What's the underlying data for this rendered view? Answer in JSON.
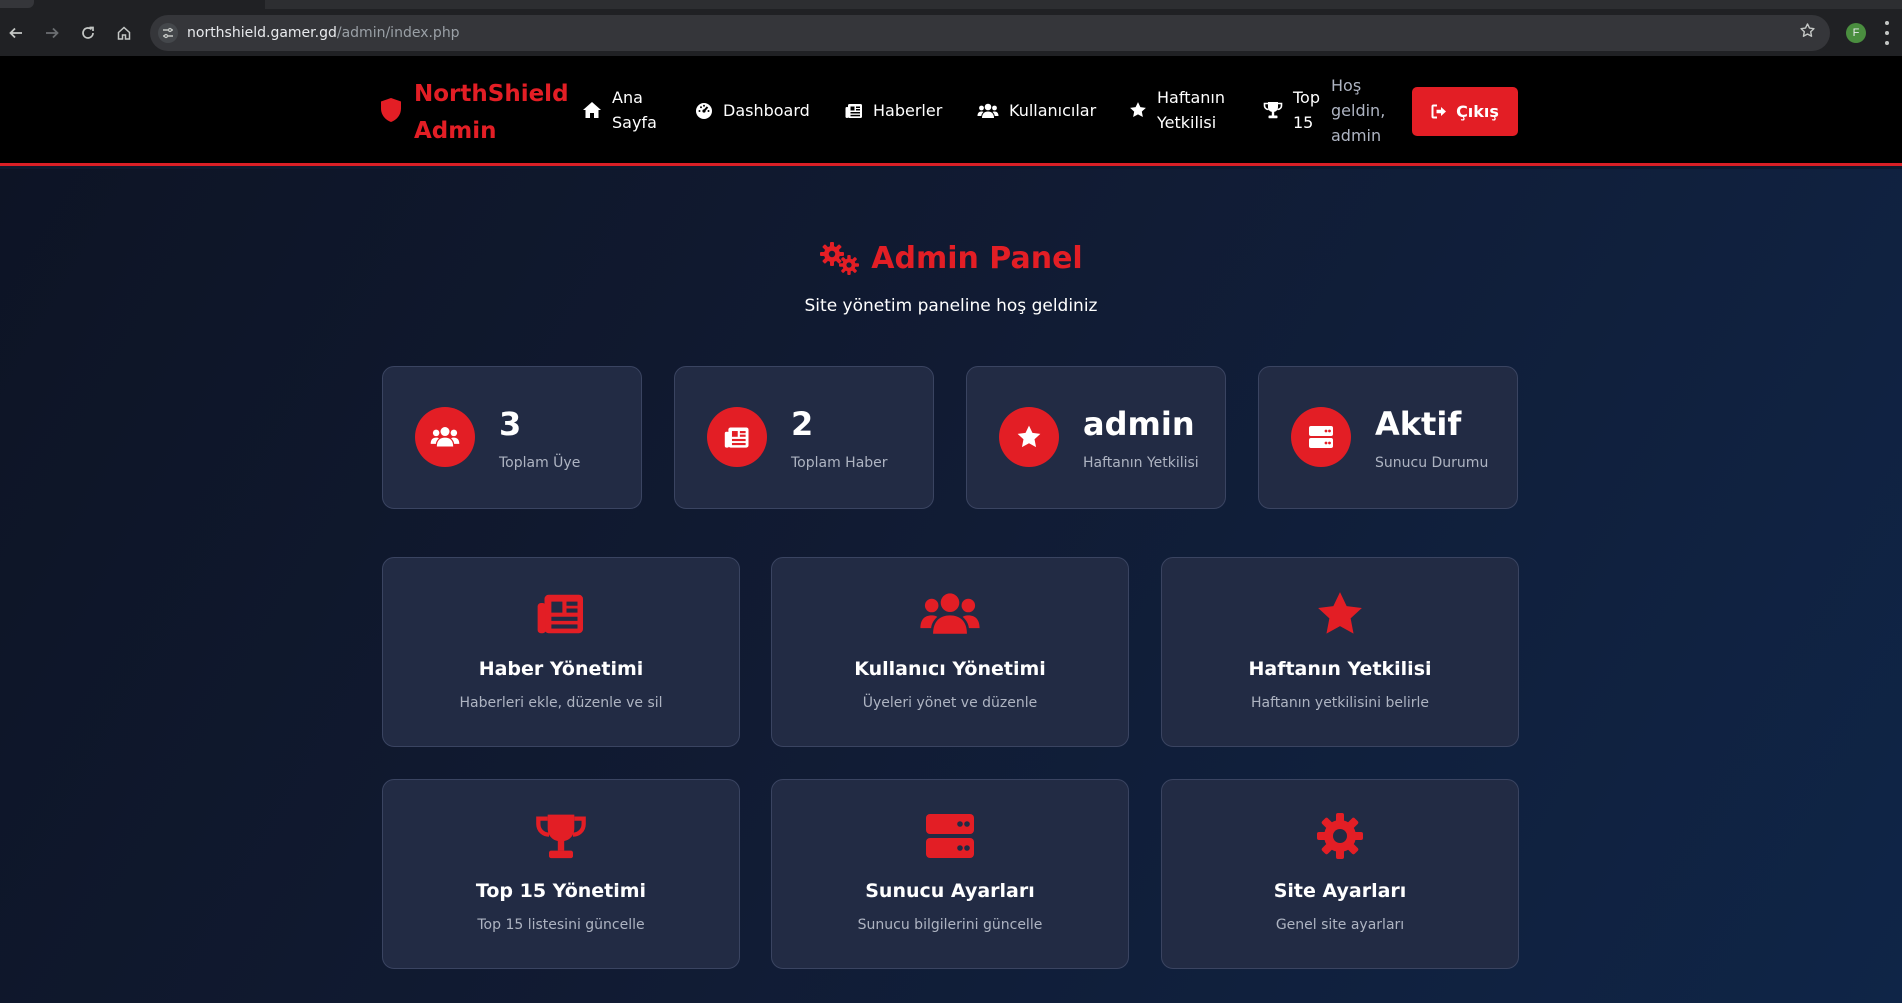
{
  "browser": {
    "url_host": "northshield.gamer.gd",
    "url_path": "/admin/index.php",
    "profile_initial": "F"
  },
  "header": {
    "brand_line1": "NorthShield",
    "brand_line2": "Admin",
    "nav": [
      {
        "line1": "Ana",
        "line2": "Sayfa",
        "icon": "home-icon"
      },
      {
        "line1": "Dashboard",
        "line2": "",
        "icon": "gauge-icon"
      },
      {
        "line1": "Haberler",
        "line2": "",
        "icon": "newspaper-icon"
      },
      {
        "line1": "Kullanıcılar",
        "line2": "",
        "icon": "users-icon"
      },
      {
        "line1": "Haftanın",
        "line2": "Yetkilisi",
        "icon": "star-icon"
      },
      {
        "line1": "Top",
        "line2": "15",
        "icon": "trophy-icon"
      }
    ],
    "welcome_line1": "Hoş",
    "welcome_line2": "geldin,",
    "welcome_line3": "admin",
    "logout_label": "Çıkış"
  },
  "panel": {
    "title": "Admin Panel",
    "subtitle": "Site yönetim paneline hoş geldiniz"
  },
  "stats": [
    {
      "value": "3",
      "label": "Toplam Üye",
      "icon": "users-icon"
    },
    {
      "value": "2",
      "label": "Toplam Haber",
      "icon": "newspaper-icon"
    },
    {
      "value": "admin",
      "label": "Haftanın Yetkilisi",
      "icon": "star-icon"
    },
    {
      "value": "Aktif",
      "label": "Sunucu Durumu",
      "icon": "server-icon"
    }
  ],
  "actions": [
    {
      "title": "Haber Yönetimi",
      "desc": "Haberleri ekle, düzenle ve sil",
      "icon": "newspaper-icon"
    },
    {
      "title": "Kullanıcı Yönetimi",
      "desc": "Üyeleri yönet ve düzenle",
      "icon": "users-icon"
    },
    {
      "title": "Haftanın Yetkilisi",
      "desc": "Haftanın yetkilisini belirle",
      "icon": "star-icon"
    },
    {
      "title": "Top 15 Yönetimi",
      "desc": "Top 15 listesini güncelle",
      "icon": "trophy-icon"
    },
    {
      "title": "Sunucu Ayarları",
      "desc": "Sunucu bilgilerini güncelle",
      "icon": "server-icon"
    },
    {
      "title": "Site Ayarları",
      "desc": "Genel site ayarları",
      "icon": "gear-icon"
    }
  ],
  "colors": {
    "accent": "#e31e25",
    "card_bg": "#222b44",
    "header_bg": "#000000"
  }
}
